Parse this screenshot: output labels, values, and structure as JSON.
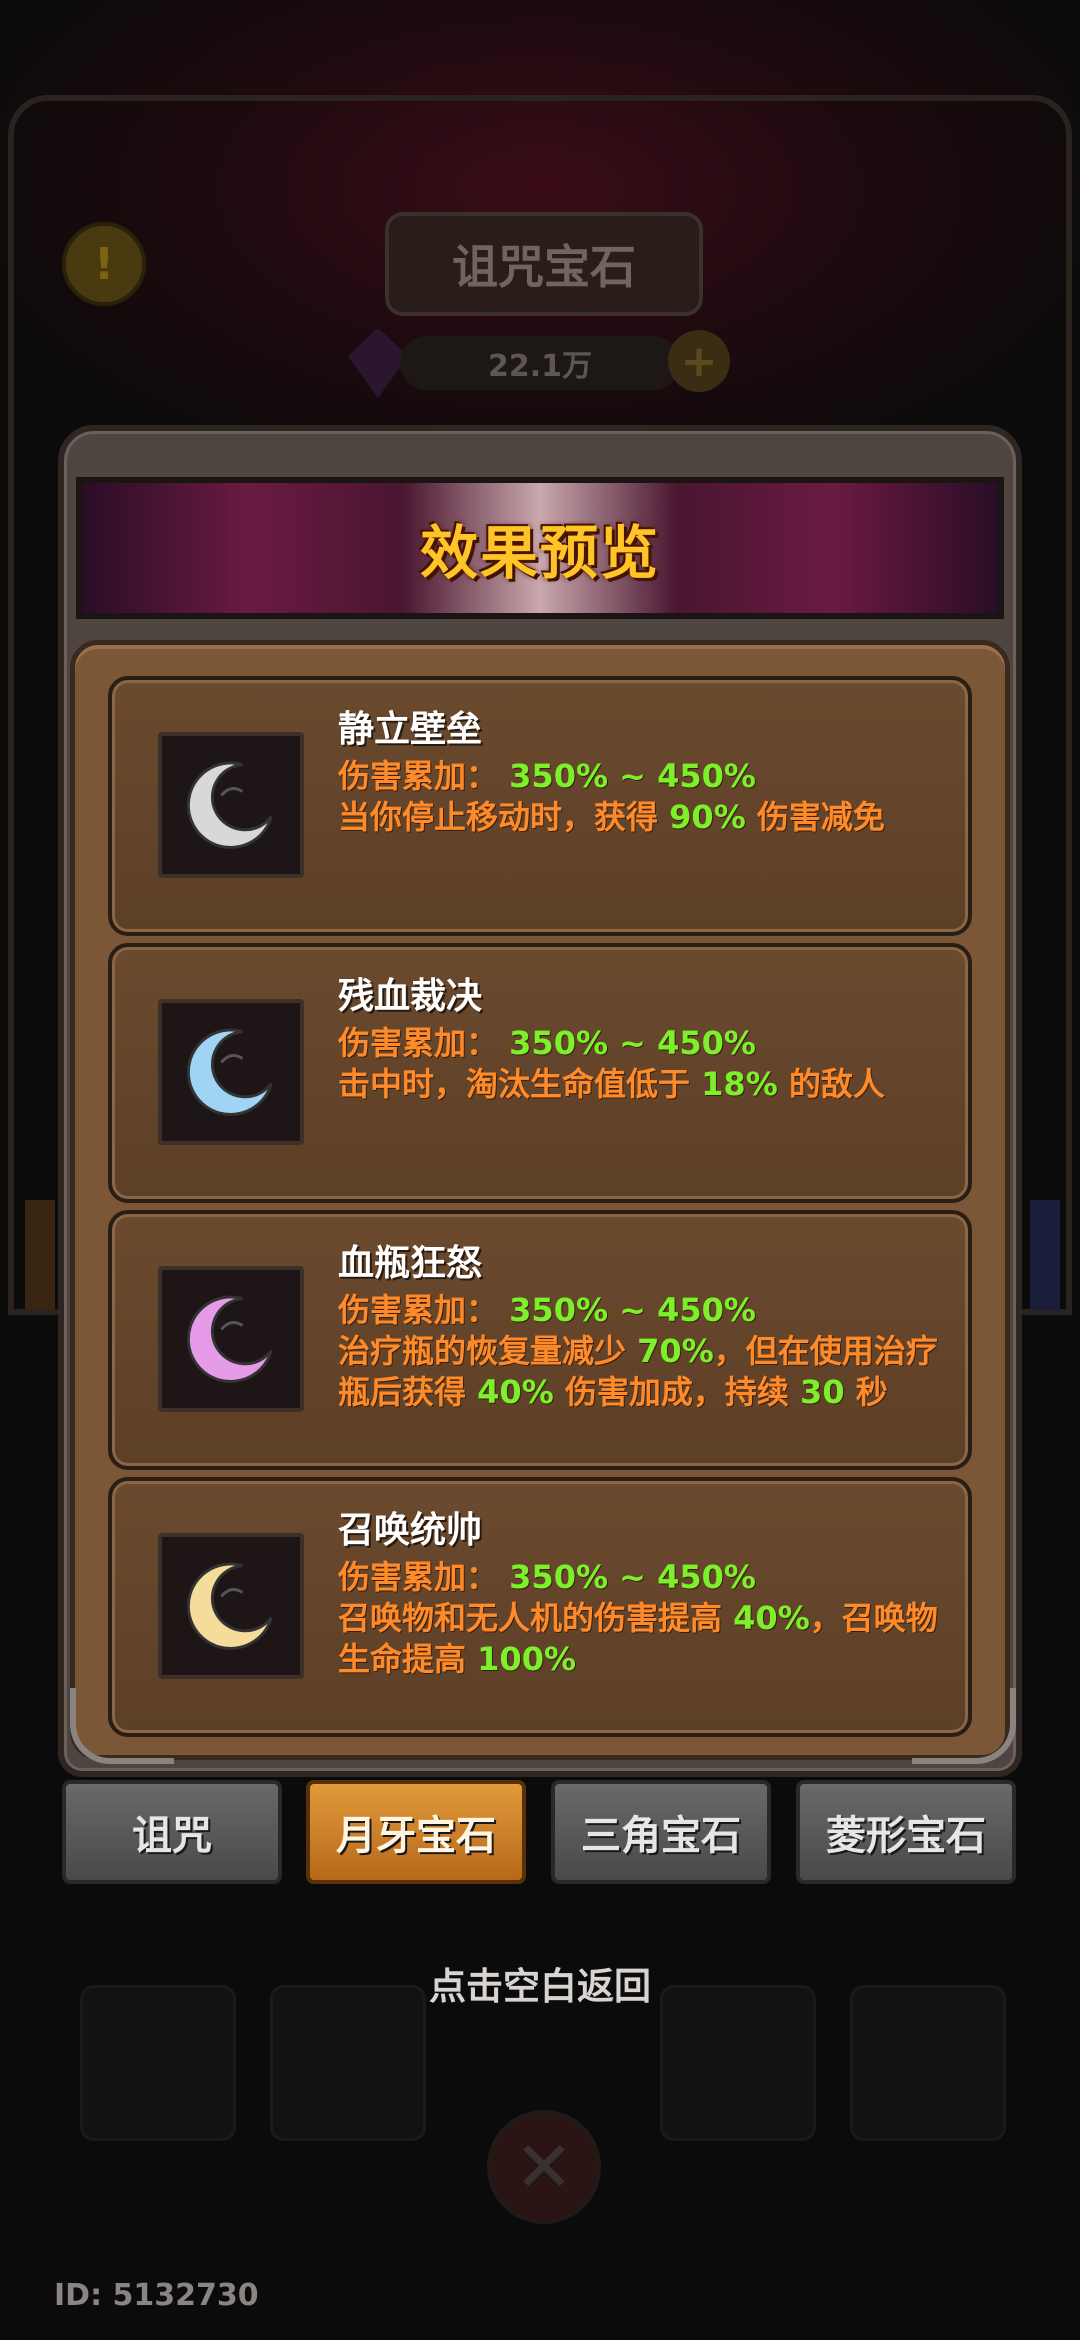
{
  "background": {
    "title": "诅咒宝石",
    "currency": "22.1万",
    "warning_symbol": "!",
    "plus_symbol": "+"
  },
  "popup": {
    "title": "效果预览",
    "effects": [
      {
        "name": "静立壁垒",
        "line1_label": "伤害累加：",
        "line1_value": "350% ~ 450%",
        "desc_parts": [
          "当你停止移动时，获得 ",
          "90%",
          " 伤害减免"
        ],
        "icon": "silver-crescent-icon",
        "icon_color": "#d8d8d8"
      },
      {
        "name": "残血裁决",
        "line1_label": "伤害累加：",
        "line1_value": "350% ~ 450%",
        "desc_parts": [
          "击中时，淘汰生命值低于 ",
          "18%",
          " 的敌人"
        ],
        "icon": "blue-crescent-icon",
        "icon_color": "#9fd4f5"
      },
      {
        "name": "血瓶狂怒",
        "line1_label": "伤害累加：",
        "line1_value": "350% ~ 450%",
        "desc_parts": [
          "治疗瓶的恢复量减少 ",
          "70%",
          "，但在使用治疗瓶后获得 ",
          "40%",
          " 伤害加成，持续 ",
          "30",
          " 秒"
        ],
        "icon": "purple-crescent-icon",
        "icon_color": "#e59be8"
      },
      {
        "name": "召唤统帅",
        "line1_label": "伤害累加：",
        "line1_value": "350% ~ 450%",
        "desc_parts": [
          "召唤物和无人机的伤害提高 ",
          "40%",
          "，召唤物生命提高 ",
          "100%"
        ],
        "icon": "gold-crescent-icon",
        "icon_color": "#f5dc9a"
      }
    ]
  },
  "tabs": [
    {
      "label": "诅咒",
      "active": false
    },
    {
      "label": "月牙宝石",
      "active": true
    },
    {
      "label": "三角宝石",
      "active": false
    },
    {
      "label": "菱形宝石",
      "active": false
    }
  ],
  "hint": "点击空白返回",
  "user_id": "ID: 5132730"
}
